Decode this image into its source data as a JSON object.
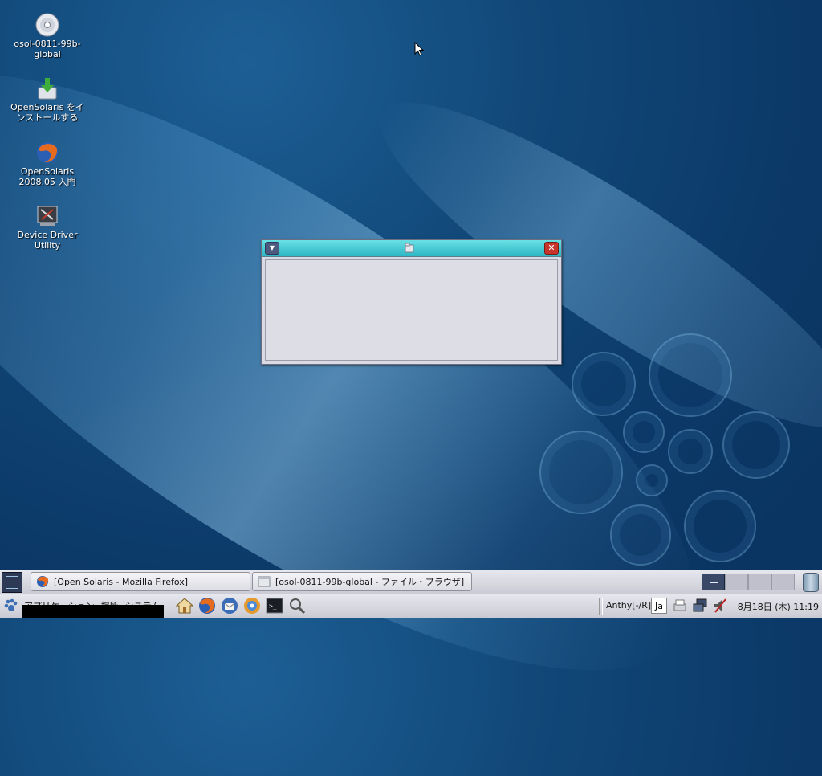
{
  "desktop": {
    "icons": [
      {
        "label": "osol-0811-99b-\nglobal",
        "icon": "cd-disc-icon"
      },
      {
        "label": "OpenSolaris をイ\nンストールする",
        "icon": "install-icon"
      },
      {
        "label": "OpenSolaris\n2008.05 入門",
        "icon": "firefox-icon"
      },
      {
        "label": "Device Driver\nUtility",
        "icon": "device-driver-icon"
      }
    ]
  },
  "window": {
    "title": "",
    "title_icon": "folder-icon",
    "menu_button": "▼",
    "close_button": "✕"
  },
  "taskbar": {
    "tasks": [
      {
        "label": "[Open Solaris - Mozilla Firefox]",
        "icon": "firefox-icon"
      },
      {
        "label": "[osol-0811-99b-global - ファイル・ブラウザ]",
        "icon": "file-browser-icon"
      }
    ],
    "workspaces": {
      "count": 4,
      "active_index": 0
    }
  },
  "bottom_panel": {
    "menus": [
      "アプリケーション",
      "場所",
      "システム"
    ],
    "launchers": [
      "home-icon",
      "firefox-icon",
      "thunderbird-icon",
      "update-icon",
      "terminal-icon",
      "search-icon"
    ],
    "input_method": "Anthy[-/R]",
    "language": "Ja",
    "tray_icons": [
      "printer-icon",
      "network-icon",
      "volume-muted-icon"
    ],
    "clock": "8月18日 (木) 11:19"
  },
  "colors": {
    "desktop_bg": "#0b3866",
    "title_bar": "#2db7c5",
    "panel": "#d8d9e0"
  }
}
